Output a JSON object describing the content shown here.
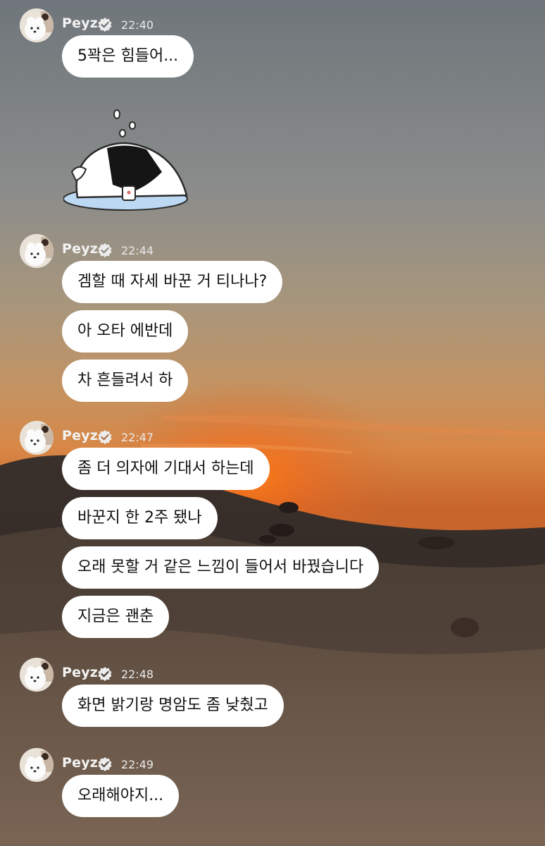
{
  "sender": {
    "name": "Peyz"
  },
  "groups": [
    {
      "time": "22:40",
      "messages": [
        "5꽉은 힘들어..."
      ],
      "sticker": "crying-rice-ball-sticker"
    },
    {
      "time": "22:44",
      "messages": [
        "겜할 때 자세 바꾼 거 티나나?",
        "아 오타 에반데",
        "차 흔들려서 하"
      ]
    },
    {
      "time": "22:47",
      "messages": [
        "좀 더 의자에 기대서 하는데",
        "바꾼지 한 2주 됐나",
        "오래 못할 거 같은 느낌이 들어서 바꿨습니다",
        "지금은 괜춘"
      ]
    },
    {
      "time": "22:48",
      "messages": [
        "화면 밝기랑 명암도 좀 낮췄고"
      ]
    },
    {
      "time": "22:49",
      "messages": [
        "오래해야지..."
      ]
    }
  ],
  "icons": {
    "verified": "verified-badge-icon",
    "avatar": "profile-avatar-dog"
  }
}
